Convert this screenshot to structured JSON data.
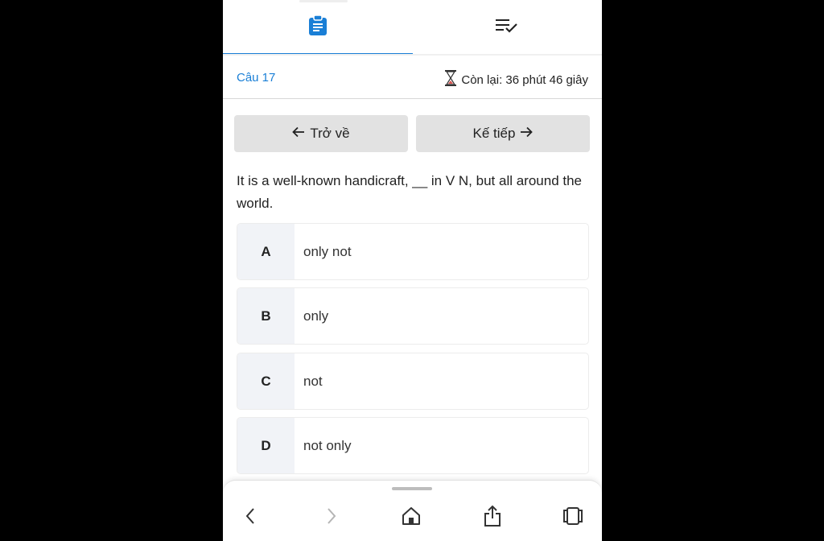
{
  "tabs": [
    {
      "icon": "clipboard-icon",
      "active": true
    },
    {
      "icon": "checklist-icon",
      "active": false
    }
  ],
  "header": {
    "question_number": "Câu 17",
    "timer_icon": "hourglass-icon",
    "time_remaining": "Còn lại: 36 phút 46 giây"
  },
  "navigation": {
    "back_label": "Trở về",
    "next_label": "Kế tiếp"
  },
  "question": {
    "text": "It is a well-known handicraft, __ in V N, but all around the world."
  },
  "options": [
    {
      "letter": "A",
      "text": "only not"
    },
    {
      "letter": "B",
      "text": "only"
    },
    {
      "letter": "C",
      "text": "not"
    },
    {
      "letter": "D",
      "text": "not only"
    }
  ],
  "browser_bar": {
    "icons": [
      "back-icon",
      "forward-icon",
      "home-icon",
      "share-icon",
      "tabs-icon"
    ]
  },
  "colors": {
    "accent": "#1a7fd6",
    "button_bg": "#e2e2e2",
    "option_letter_bg": "#f1f3f7",
    "hourglass": "#d9534f"
  }
}
